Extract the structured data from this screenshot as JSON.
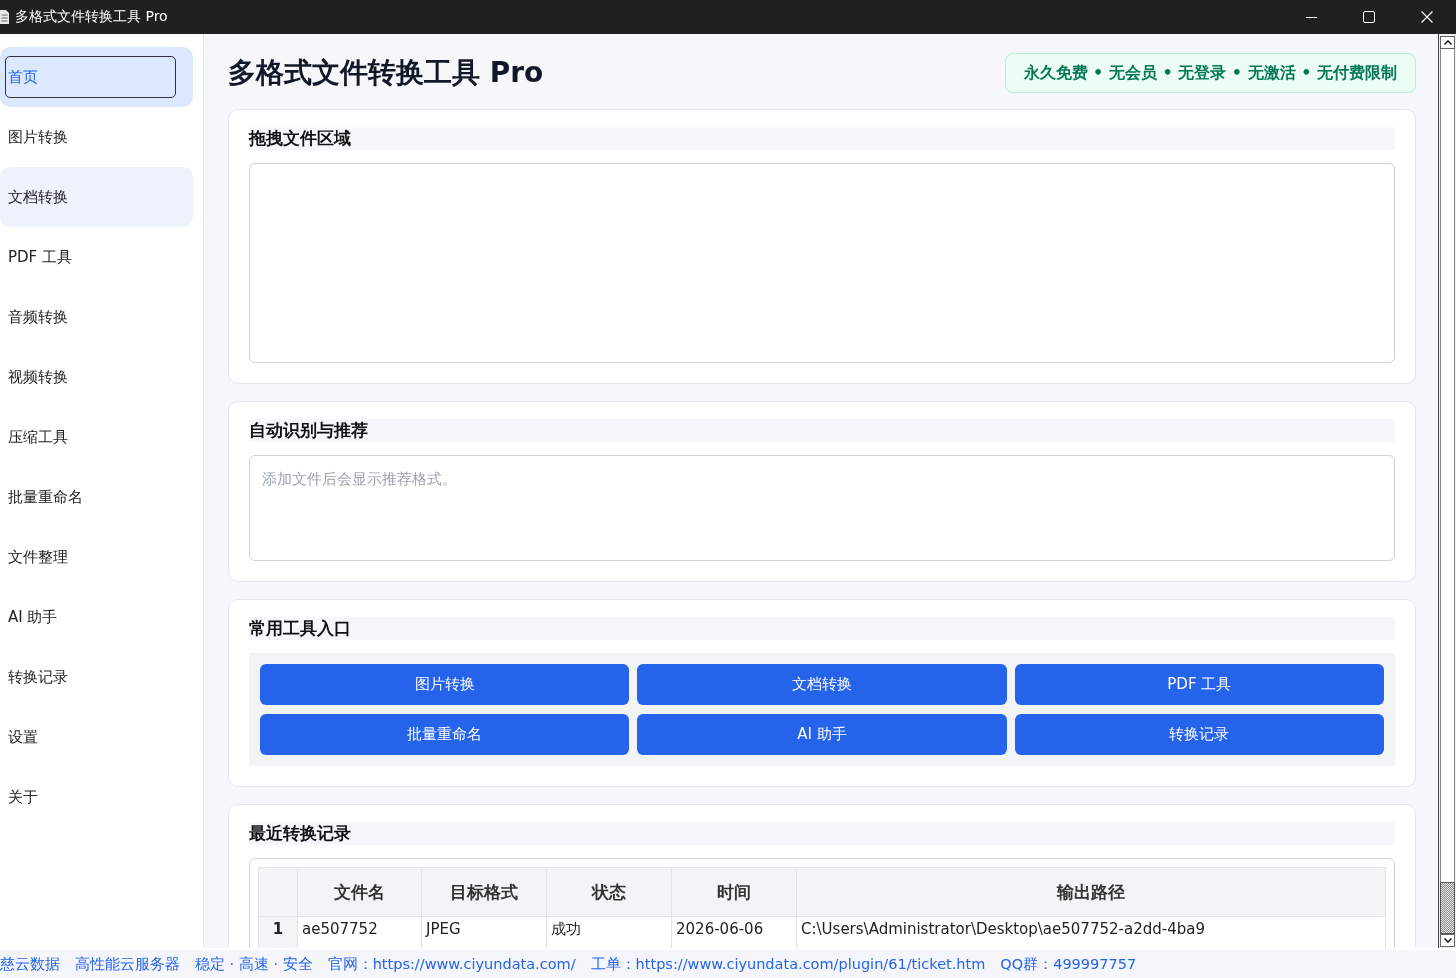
{
  "window": {
    "title": "多格式文件转换工具 Pro"
  },
  "sidebar": {
    "items": [
      {
        "label": "首页",
        "selected": true,
        "hovered": false
      },
      {
        "label": "图片转换",
        "selected": false,
        "hovered": false
      },
      {
        "label": "文档转换",
        "selected": false,
        "hovered": true
      },
      {
        "label": "PDF 工具",
        "selected": false,
        "hovered": false
      },
      {
        "label": "音频转换",
        "selected": false,
        "hovered": false
      },
      {
        "label": "视频转换",
        "selected": false,
        "hovered": false
      },
      {
        "label": "压缩工具",
        "selected": false,
        "hovered": false
      },
      {
        "label": "批量重命名",
        "selected": false,
        "hovered": false
      },
      {
        "label": "文件整理",
        "selected": false,
        "hovered": false
      },
      {
        "label": "AI 助手",
        "selected": false,
        "hovered": false
      },
      {
        "label": "转换记录",
        "selected": false,
        "hovered": false
      },
      {
        "label": "设置",
        "selected": false,
        "hovered": false
      },
      {
        "label": "关于",
        "selected": false,
        "hovered": false
      }
    ]
  },
  "header": {
    "title": "多格式文件转换工具 Pro",
    "badge": "永久免费 • 无会员 • 无登录 • 无激活 • 无付费限制"
  },
  "cards": [
    {
      "kind": "dropzone",
      "title": "拖拽文件区域"
    },
    {
      "kind": "textarea",
      "title": "自动识别与推荐",
      "placeholder": "添加文件后会显示推荐格式。"
    },
    {
      "kind": "buttons",
      "title": "常用工具入口",
      "buttons": [
        "图片转换",
        "文档转换",
        "PDF 工具",
        "批量重命名",
        "AI 助手",
        "转换记录"
      ]
    },
    {
      "kind": "table",
      "title": "最近转换记录",
      "table": {
        "columns": [
          "文件名",
          "目标格式",
          "状态",
          "时间",
          "输出路径"
        ],
        "rows": [
          {
            "index": "1",
            "cells": [
              "ae507752",
              "JPEG",
              "成功",
              "2026-06-06",
              "C:\\Users\\Administrator\\Desktop\\ae507752-a2dd-4ba9"
            ]
          }
        ]
      }
    }
  ],
  "status_bar": {
    "items": [
      "慈云数据",
      "高性能云服务器",
      "稳定 · 高速 · 安全",
      "官网：https://www.ciyundata.com/",
      "工单：https://www.ciyundata.com/plugin/61/ticket.htm",
      "QQ群：499997757"
    ]
  }
}
